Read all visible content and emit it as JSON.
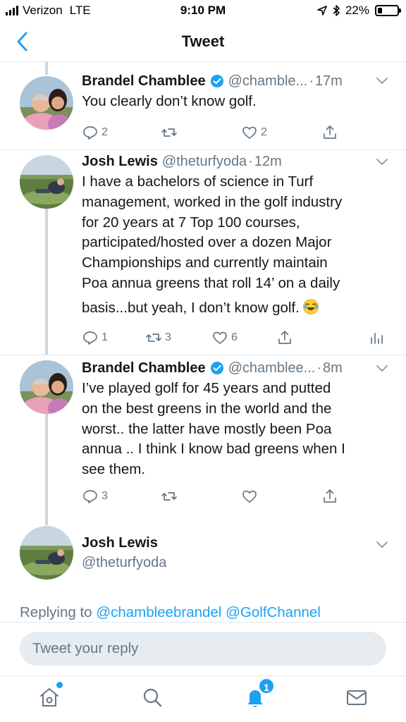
{
  "status_bar": {
    "carrier": "Verizon",
    "network": "LTE",
    "time": "9:10 PM",
    "battery": "22%",
    "battery_level": 0.22
  },
  "header": {
    "title": "Tweet",
    "back_icon": "chevron-left-icon"
  },
  "tweets": [
    {
      "name": "Brandel Chamblee",
      "verified": true,
      "handle": "@chamble...",
      "time": "17m",
      "lines": [
        "You clearly don’t know golf."
      ],
      "reply_count": "2",
      "retweet_count": "",
      "like_count": "2"
    },
    {
      "name": "Josh Lewis",
      "verified": false,
      "handle": "@theturfyoda",
      "time": "12m",
      "lines": [
        "I have a bachelors of science in Turf",
        "management, worked in the golf industry",
        "for 20 years at 7 Top 100 courses,",
        "participated/hosted over a dozen Major",
        "Championships and currently maintain",
        "Poa annua greens that roll 14’ on a daily",
        "basis...but yeah, I don’t know golf."
      ],
      "emoji": "laughing-tears-emoji",
      "reply_count": "1",
      "retweet_count": "3",
      "like_count": "6"
    },
    {
      "name": "Brandel Chamblee",
      "verified": true,
      "handle": "@chamblee...",
      "time": "8m",
      "lines": [
        "I’ve played golf for 45 years and putted",
        "on the best greens in the world and the",
        "worst.. the latter have mostly been Poa",
        "annua .. I think I know bad greens when I",
        "see them."
      ],
      "reply_count": "3",
      "retweet_count": "",
      "like_count": ""
    }
  ],
  "compose_author": {
    "name": "Josh Lewis",
    "handle": "@theturfyoda"
  },
  "replying": {
    "prefix": "Replying to",
    "mention_1": "@chambleebrandel",
    "mention_2": "@GolfChannel"
  },
  "reply_box": {
    "placeholder": "Tweet your reply"
  },
  "tab_bar": {
    "notifications_badge": "1",
    "icons": [
      "home-icon",
      "search-icon",
      "notifications-bell-icon",
      "messages-envelope-icon"
    ]
  },
  "colors": {
    "accent": "#1da1f2",
    "secondary_text": "#657786",
    "divider": "#e1e8ed",
    "thread_line": "#ccd6dd"
  }
}
